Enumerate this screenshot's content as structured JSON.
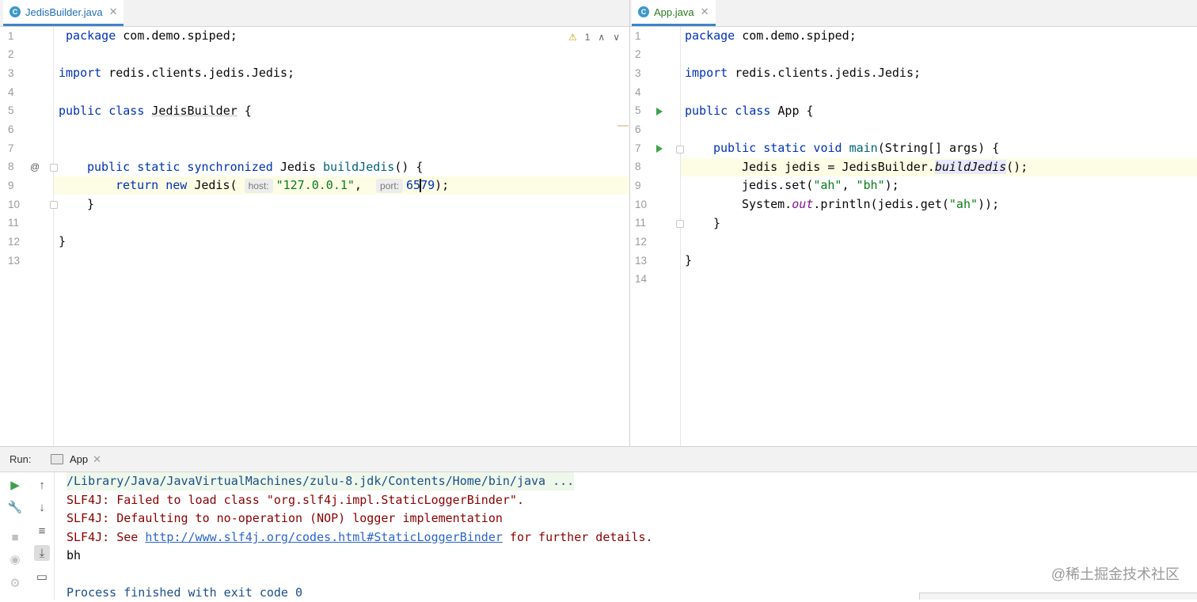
{
  "left_editor": {
    "tab": {
      "icon": "class-c-icon",
      "icon_letter": "C",
      "label": "JedisBuilder.java"
    },
    "warnings": {
      "count": "1"
    },
    "line_numbers": [
      "1",
      "2",
      "3",
      "4",
      "5",
      "6",
      "7",
      "8",
      "9",
      "10",
      "11",
      "12",
      "13"
    ],
    "code": {
      "l1_kw": "package",
      "l1_rest": " com.demo.spiped;",
      "l3_kw": "import",
      "l3_rest": " redis.clients.jedis.Jedis;",
      "l5_kw": "public class",
      "l5_name": "JedisBuilder",
      "l5_rest": " {",
      "l8_kw": "public static synchronized",
      "l8_type": " Jedis ",
      "l8_fn": "buildJedis",
      "l8_rest": "() {",
      "l9_kw": "return new",
      "l9_type": " Jedis(",
      "l9_hint_host": "host:",
      "l9_str": "\"127.0.0.1\"",
      "l9_comma": ",",
      "l9_hint_port": "port:",
      "l9_num_a": "65",
      "l9_num_b": "79",
      "l9_end": ");",
      "l10": "}",
      "l12": "}"
    },
    "gutter_at": "@"
  },
  "right_editor": {
    "tab": {
      "icon": "class-run-c-icon",
      "icon_letter": "C",
      "label": "App.java"
    },
    "line_numbers": [
      "1",
      "2",
      "3",
      "4",
      "5",
      "6",
      "7",
      "8",
      "9",
      "10",
      "11",
      "12",
      "13",
      "14"
    ],
    "code": {
      "l1_kw": "package",
      "l1_rest": " com.demo.spiped;",
      "l3_kw": "import",
      "l3_rest": " redis.clients.jedis.Jedis;",
      "l5_kw": "public class",
      "l5_rest": " App {",
      "l7_kw": "public static void",
      "l7_fn": " main",
      "l7_rest": "(String[] args) {",
      "l8_a": "Jedis jedis = JedisBuilder.",
      "l8_fn": "buildJedis",
      "l8_b": "();",
      "l9_a": "jedis.set(",
      "l9_s1": "\"ah\"",
      "l9_b": ", ",
      "l9_s2": "\"bh\"",
      "l9_c": ");",
      "l10_a": "System.",
      "l10_out": "out",
      "l10_b": ".println(jedis.get(",
      "l10_s": "\"ah\"",
      "l10_c": "));",
      "l11": "}",
      "l13": "}"
    }
  },
  "run_window": {
    "title": "Run:",
    "tab_label": "App",
    "toolbar": [
      "rerun-icon",
      "wrench-icon",
      "stop-icon",
      "camera-icon",
      "settings-icon",
      "up-arrow-icon",
      "down-arrow-icon",
      "soft-wrap-icon",
      "scroll-to-end-icon",
      "print-icon"
    ],
    "console": {
      "cmd": "/Library/Java/JavaVirtualMachines/zulu-8.jdk/Contents/Home/bin/java ...",
      "err1": "SLF4J: Failed to load class \"org.slf4j.impl.StaticLoggerBinder\".",
      "err2": "SLF4J: Defaulting to no-operation (NOP) logger implementation",
      "err3_a": "SLF4J: See ",
      "err3_link": "http://www.slf4j.org/codes.html#StaticLoggerBinder",
      "err3_b": " for further details.",
      "output": "bh",
      "exit": "Process finished with exit code 0"
    }
  },
  "watermark": "@稀土掘金技术社区",
  "colors": {
    "keyword": "#0033b3",
    "string": "#067d17",
    "function": "#00627a",
    "static_field": "#871094",
    "error": "#8b0000",
    "tab_underline": "#4083c9"
  }
}
